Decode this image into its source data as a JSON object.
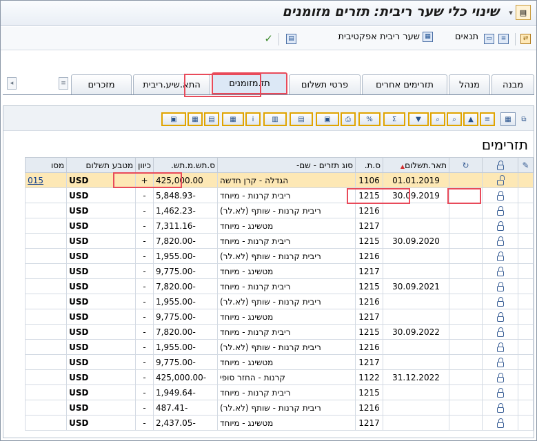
{
  "window": {
    "title": "שינוי כלי שער ריבית: תזרים מזומנים"
  },
  "app_toolbar": {
    "effective_rate_label": "שער ריבית אפקטיבית",
    "conditions_label": "תנאים"
  },
  "tabs": [
    {
      "label": "מבנה"
    },
    {
      "label": "מנהל"
    },
    {
      "label": "תזרימים אחרים"
    },
    {
      "label": "פרטי תשלום"
    },
    {
      "label": "תז.מזומנים",
      "active": true
    },
    {
      "label": "התא.שיע.ריבית"
    },
    {
      "label": "מזכרים"
    }
  ],
  "section": {
    "title": "תזרימים"
  },
  "grid": {
    "headers": {
      "date": "תאר.תשלום",
      "ft": "ס.ת.",
      "type": "סוג תזרים - שם-",
      "amount": "ס.תש.מ.תש.",
      "dir": "כיוון",
      "currency": "מטבע תשלום",
      "extra": "מסו"
    },
    "rows": [
      {
        "date": "01.01.2019",
        "ft": "1106",
        "type": "הגדלה - קרן חדשה",
        "amount": "425,000.00",
        "dir": "+",
        "currency": "USD",
        "extra": "015",
        "lock": "open"
      },
      {
        "date": "30.09.2019",
        "ft": "1215",
        "type": "ריבית קרנות - מיוחד",
        "amount": "-5,848.93",
        "dir": "-",
        "currency": "USD",
        "extra": "",
        "lock": "closed"
      },
      {
        "date": "",
        "ft": "1216",
        "type": "ריבית קרנות - שותף (לא.לר)",
        "amount": "-1,462.23",
        "dir": "-",
        "currency": "USD",
        "extra": "",
        "lock": "closed"
      },
      {
        "date": "",
        "ft": "1217",
        "type": "מטשינג - מיוחד",
        "amount": "-7,311.16",
        "dir": "-",
        "currency": "USD",
        "extra": "",
        "lock": "closed"
      },
      {
        "date": "30.09.2020",
        "ft": "1215",
        "type": "ריבית קרנות - מיוחד",
        "amount": "-7,820.00",
        "dir": "-",
        "currency": "USD",
        "extra": "",
        "lock": "closed"
      },
      {
        "date": "",
        "ft": "1216",
        "type": "ריבית קרנות - שותף (לא.לר)",
        "amount": "-1,955.00",
        "dir": "-",
        "currency": "USD",
        "extra": "",
        "lock": "closed"
      },
      {
        "date": "",
        "ft": "1217",
        "type": "מטשינג - מיוחד",
        "amount": "-9,775.00",
        "dir": "-",
        "currency": "USD",
        "extra": "",
        "lock": "closed"
      },
      {
        "date": "30.09.2021",
        "ft": "1215",
        "type": "ריבית קרנות - מיוחד",
        "amount": "-7,820.00",
        "dir": "-",
        "currency": "USD",
        "extra": "",
        "lock": "closed"
      },
      {
        "date": "",
        "ft": "1216",
        "type": "ריבית קרנות - שותף (לא.לר)",
        "amount": "-1,955.00",
        "dir": "-",
        "currency": "USD",
        "extra": "",
        "lock": "closed"
      },
      {
        "date": "",
        "ft": "1217",
        "type": "מטשינג - מיוחד",
        "amount": "-9,775.00",
        "dir": "-",
        "currency": "USD",
        "extra": "",
        "lock": "closed"
      },
      {
        "date": "30.09.2022",
        "ft": "1215",
        "type": "ריבית קרנות - מיוחד",
        "amount": "-7,820.00",
        "dir": "-",
        "currency": "USD",
        "extra": "",
        "lock": "closed"
      },
      {
        "date": "",
        "ft": "1216",
        "type": "ריבית קרנות - שותף (לא.לר)",
        "amount": "-1,955.00",
        "dir": "-",
        "currency": "USD",
        "extra": "",
        "lock": "closed"
      },
      {
        "date": "",
        "ft": "1217",
        "type": "מטשינג - מיוחד",
        "amount": "-9,775.00",
        "dir": "-",
        "currency": "USD",
        "extra": "",
        "lock": "closed"
      },
      {
        "date": "31.12.2022",
        "ft": "1122",
        "type": "קרנות - החזר סופי",
        "amount": "-425,000.00",
        "dir": "-",
        "currency": "USD",
        "extra": "",
        "lock": "closed"
      },
      {
        "date": "",
        "ft": "1215",
        "type": "ריבית קרנות - מיוחד",
        "amount": "-1,949.64",
        "dir": "-",
        "currency": "USD",
        "extra": "",
        "lock": "closed"
      },
      {
        "date": "",
        "ft": "1216",
        "type": "ריבית קרנות - שותף (לא.לר)",
        "amount": "-487.41",
        "dir": "-",
        "currency": "USD",
        "extra": "",
        "lock": "closed"
      },
      {
        "date": "",
        "ft": "1217",
        "type": "מטשינג - מיוחד",
        "amount": "-2,437.05",
        "dir": "-",
        "currency": "USD",
        "extra": "",
        "lock": "closed"
      }
    ]
  },
  "colors": {
    "highlight_box": "#e84a5a",
    "selected_row": "#fde8b5",
    "header_bg": "#e5ebf2"
  }
}
